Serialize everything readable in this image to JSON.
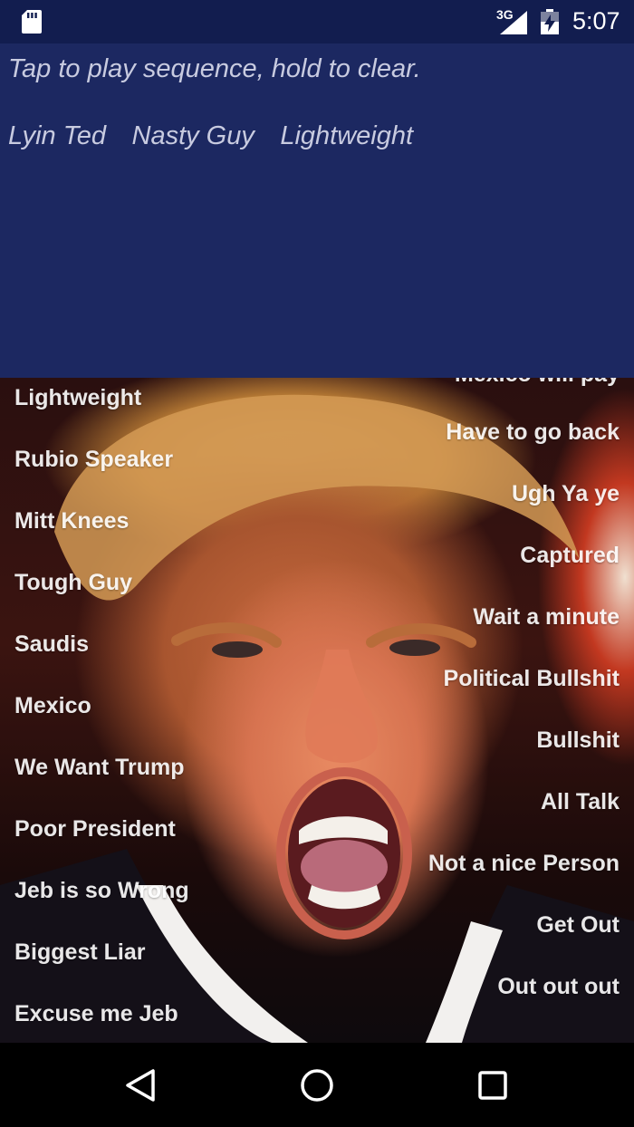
{
  "status_bar": {
    "network": "3G",
    "time": "5:07"
  },
  "sequence_panel": {
    "instructions": "Tap to play sequence, hold to clear.",
    "sequence": [
      "Lyin Ted",
      "Nasty Guy",
      "Lightweight"
    ]
  },
  "sound_buttons_left": [
    "Lightweight",
    "Rubio Speaker",
    "Mitt Knees",
    "Tough Guy",
    "Saudis",
    "Mexico",
    "We Want Trump",
    "Poor President",
    "Jeb is so Wrong",
    "Biggest Liar",
    "Excuse me Jeb"
  ],
  "sound_buttons_right": [
    "Mexico will pay",
    "Have to go back",
    "Ugh Ya ye",
    "Captured",
    "Wait a minute",
    "Political Bullshit",
    "Bullshit",
    "All Talk",
    "Not a nice Person",
    "Get Out",
    "Out out out"
  ],
  "colors": {
    "status_bar_bg": "#121d4f",
    "panel_bg": "#1c2861",
    "panel_text": "#c8cbe0",
    "button_text": "#ffffff"
  },
  "icons": {
    "sd_card": "sd-card-icon",
    "signal": "signal-icon",
    "battery": "battery-charging-icon",
    "back": "back-icon",
    "home": "home-icon",
    "recents": "recents-icon"
  }
}
